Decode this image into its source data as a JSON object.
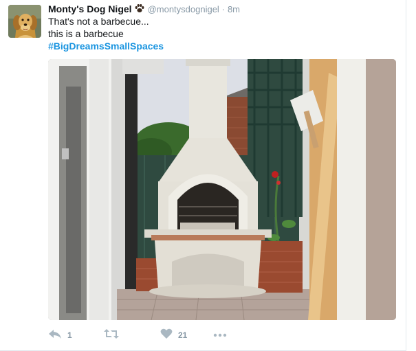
{
  "tweet": {
    "author_name": "Monty's Dog Nigel",
    "handle": "@montysdognigel",
    "separator": "·",
    "time": "8m",
    "text_line1": "That's not a barbecue...",
    "text_line2": "this is a barbecue",
    "hashtag": "#BigDreamsSmallSpaces"
  },
  "actions": {
    "reply_count": "1",
    "retweet_count": "",
    "like_count": "21"
  },
  "icons": {
    "reply": "reply-icon",
    "retweet": "retweet-icon",
    "like": "heart-icon",
    "more": "more-icon",
    "badge": "paw-icon"
  },
  "colors": {
    "link": "#1b95e0",
    "muted": "#8899a6",
    "text": "#14171a"
  }
}
